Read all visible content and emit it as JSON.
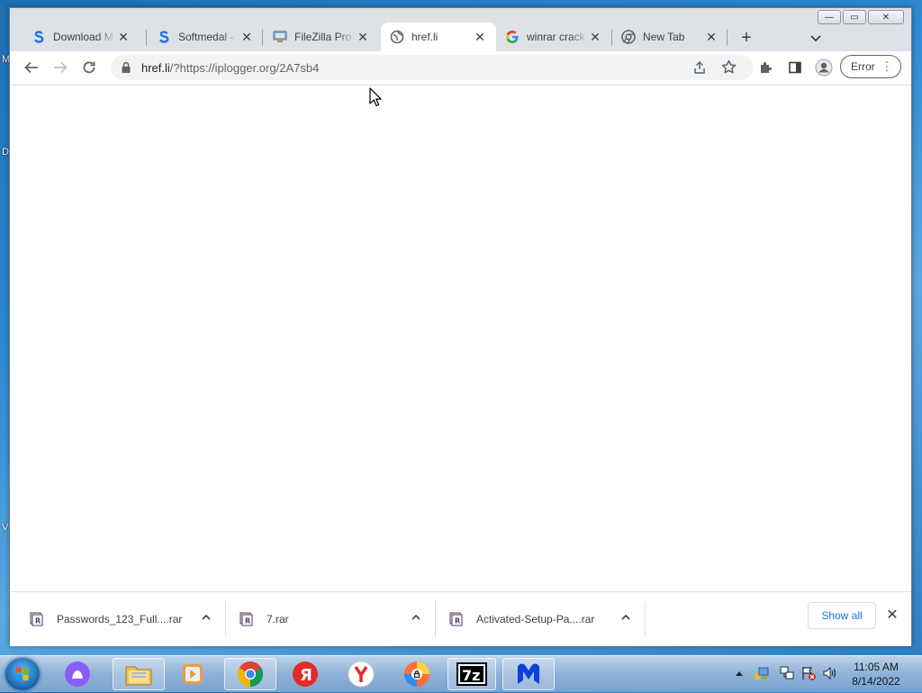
{
  "desktop": {
    "edge_letters": [
      "M",
      "D",
      "V"
    ]
  },
  "browser": {
    "window_controls": {
      "minimize": "—",
      "maximize": "▭",
      "close": "✕"
    },
    "tabs": [
      {
        "title": "Download M",
        "favicon": "softmedal-icon",
        "active": false
      },
      {
        "title": "Softmedal -",
        "favicon": "softmedal-icon",
        "active": false
      },
      {
        "title": "FileZilla Pro",
        "favicon": "filezilla-icon",
        "active": false
      },
      {
        "title": "href.li",
        "favicon": "globe-icon",
        "active": true
      },
      {
        "title": "winrar crack",
        "favicon": "google-icon",
        "active": false
      },
      {
        "title": "New Tab",
        "favicon": "chrome-icon",
        "active": false
      }
    ],
    "new_tab_label": "+",
    "omnibox": {
      "host": "href.li",
      "path": "/?https://iplogger.org/2A7sb4"
    },
    "profile_error_label": "Error",
    "download_shelf": {
      "items": [
        {
          "filename": "Passwords_123_Full....rar",
          "icon": "winrar-icon"
        },
        {
          "filename": "7.rar",
          "icon": "winrar-icon"
        },
        {
          "filename": "Activated-Setup-Pa....rar",
          "icon": "winrar-icon"
        }
      ],
      "show_all_label": "Show all"
    }
  },
  "taskbar": {
    "apps": [
      {
        "name": "alice-assistant-icon",
        "open": false
      },
      {
        "name": "file-explorer-icon",
        "open": true
      },
      {
        "name": "media-player-icon",
        "open": false
      },
      {
        "name": "chrome-icon",
        "open": true
      },
      {
        "name": "yandex-icon",
        "open": false
      },
      {
        "name": "yandex-browser-icon",
        "open": false
      },
      {
        "name": "firefox-like-icon",
        "open": false
      },
      {
        "name": "7zip-icon",
        "open": true
      },
      {
        "name": "malwarebytes-icon",
        "open": true
      }
    ],
    "sevenzip_label": "7z",
    "clock": {
      "time": "11:05 AM",
      "date": "8/14/2022"
    }
  },
  "colors": {
    "chrome_frame": "#dee1e6",
    "link_blue": "#1a73e8",
    "error_dots": "#e37400",
    "taskbar": "#8fb1d6"
  }
}
